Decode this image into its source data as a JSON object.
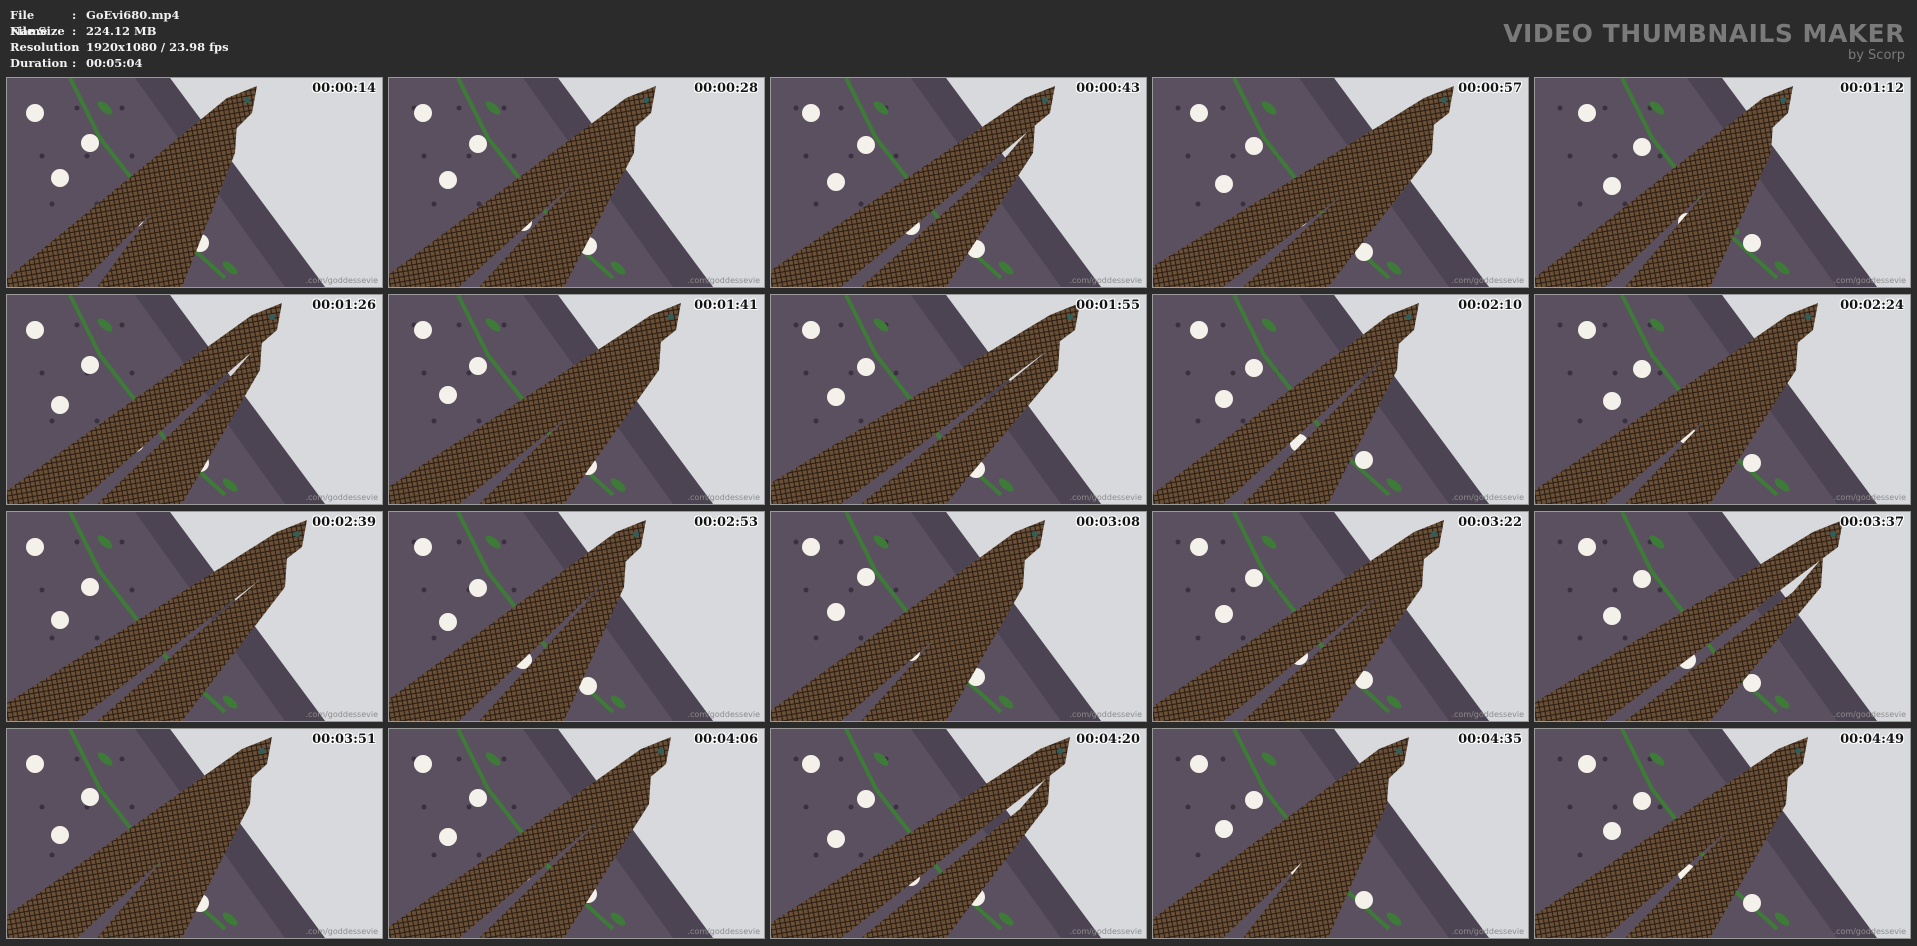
{
  "file_info": {
    "rows": [
      {
        "key": "File Name",
        "value": "GoEvi680.mp4"
      },
      {
        "key": "File Size",
        "value": "224.12 MB"
      },
      {
        "key": "Resolution",
        "value": "1920x1080 / 23.98 fps"
      },
      {
        "key": "Duration",
        "value": "00:05:04"
      }
    ]
  },
  "branding": {
    "title": "VIDEO THUMBNAILS MAKER",
    "subtitle": "by Scorp"
  },
  "thumbnails": [
    {
      "time": "00:00:14",
      "watermark": ".com/goddessevie"
    },
    {
      "time": "00:00:28",
      "watermark": ".com/goddessevie"
    },
    {
      "time": "00:00:43",
      "watermark": ".com/goddessevie"
    },
    {
      "time": "00:00:57",
      "watermark": ".com/goddessevie"
    },
    {
      "time": "00:01:12",
      "watermark": ".com/goddessevie"
    },
    {
      "time": "00:01:26",
      "watermark": ".com/goddessevie"
    },
    {
      "time": "00:01:41",
      "watermark": ".com/goddessevie"
    },
    {
      "time": "00:01:55",
      "watermark": ".com/goddessevie"
    },
    {
      "time": "00:02:10",
      "watermark": ".com/goddessevie"
    },
    {
      "time": "00:02:24",
      "watermark": ".com/goddessevie"
    },
    {
      "time": "00:02:39",
      "watermark": ".com/goddessevie"
    },
    {
      "time": "00:02:53",
      "watermark": ".com/goddessevie"
    },
    {
      "time": "00:03:08",
      "watermark": ".com/goddessevie"
    },
    {
      "time": "00:03:22",
      "watermark": ".com/goddessevie"
    },
    {
      "time": "00:03:37",
      "watermark": ".com/goddessevie"
    },
    {
      "time": "00:03:51",
      "watermark": ".com/goddessevie"
    },
    {
      "time": "00:04:06",
      "watermark": ".com/goddessevie"
    },
    {
      "time": "00:04:20",
      "watermark": ".com/goddessevie"
    },
    {
      "time": "00:04:35",
      "watermark": ".com/goddessevie"
    },
    {
      "time": "00:04:49",
      "watermark": ".com/goddessevie"
    }
  ],
  "colors": {
    "background": "#2b2b2b",
    "wall": "#d7d9dd",
    "sofa": "#5b5060",
    "stocking": "#6b5038",
    "flower": "#f4f1ea",
    "leaf": "#3e7a38"
  }
}
